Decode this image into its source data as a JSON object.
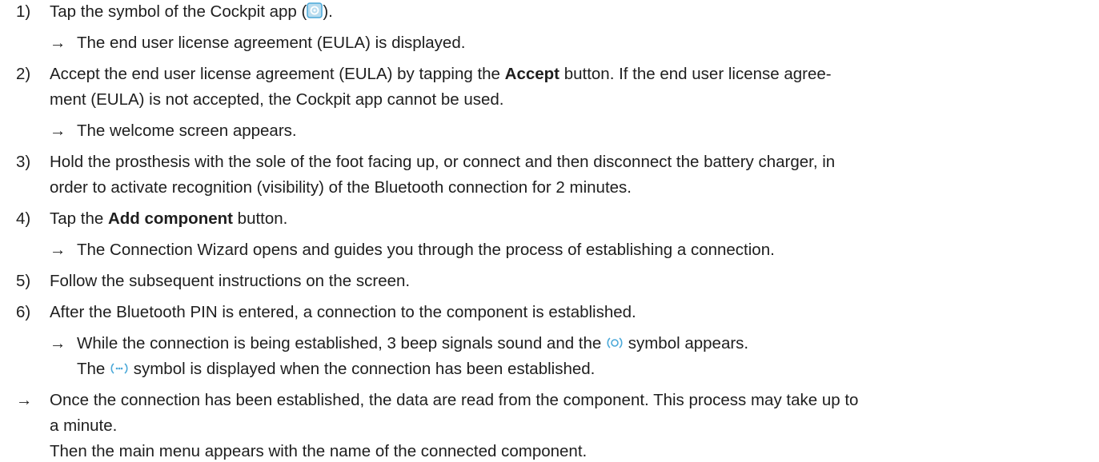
{
  "colors": {
    "text": "#1e1e1e",
    "icon_accent": "#4aa8d8"
  },
  "arrow_glyph": "→",
  "steps": [
    {
      "number": "1)",
      "pre": "Tap the symbol of the Cockpit app (",
      "icon": "cockpit-app-icon",
      "post": ").",
      "result": "The end user license agreement (EULA) is displayed."
    },
    {
      "number": "2)",
      "pre": "Accept the end user license agreement (EULA) by tapping the ",
      "bold": "Accept",
      "post": " button. If the end user license agree-",
      "line2": "ment (EULA) is not accepted, the Cockpit app cannot be used.",
      "result": "The welcome screen appears."
    },
    {
      "number": "3)",
      "text": "Hold the prosthesis with the sole of the foot facing up, or connect and then disconnect the battery charger, in",
      "line2": "order to activate recognition (visibility) of the Bluetooth connection for 2 minutes."
    },
    {
      "number": "4)",
      "pre": "Tap the ",
      "bold": "Add component",
      "post": " button.",
      "result": "The Connection Wizard opens and guides you through the process of establishing a connection."
    },
    {
      "number": "5)",
      "text": "Follow the subsequent instructions on the screen."
    },
    {
      "number": "6)",
      "text": "After the Bluetooth PIN is entered, a connection to the component is established.",
      "result_pre": "While the connection is being established, 3 beep signals sound and the ",
      "result_icon": "connecting-icon",
      "result_post": " symbol appears.",
      "result2_pre": "The ",
      "result2_icon": "connected-icon",
      "result2_post": " symbol is displayed when the connection has been established."
    }
  ],
  "final_result": {
    "line1": "Once the connection has been established, the data are read from the component. This process may take up to",
    "line2": "a minute.",
    "line3": "Then the main menu appears with the name of the connected component."
  }
}
